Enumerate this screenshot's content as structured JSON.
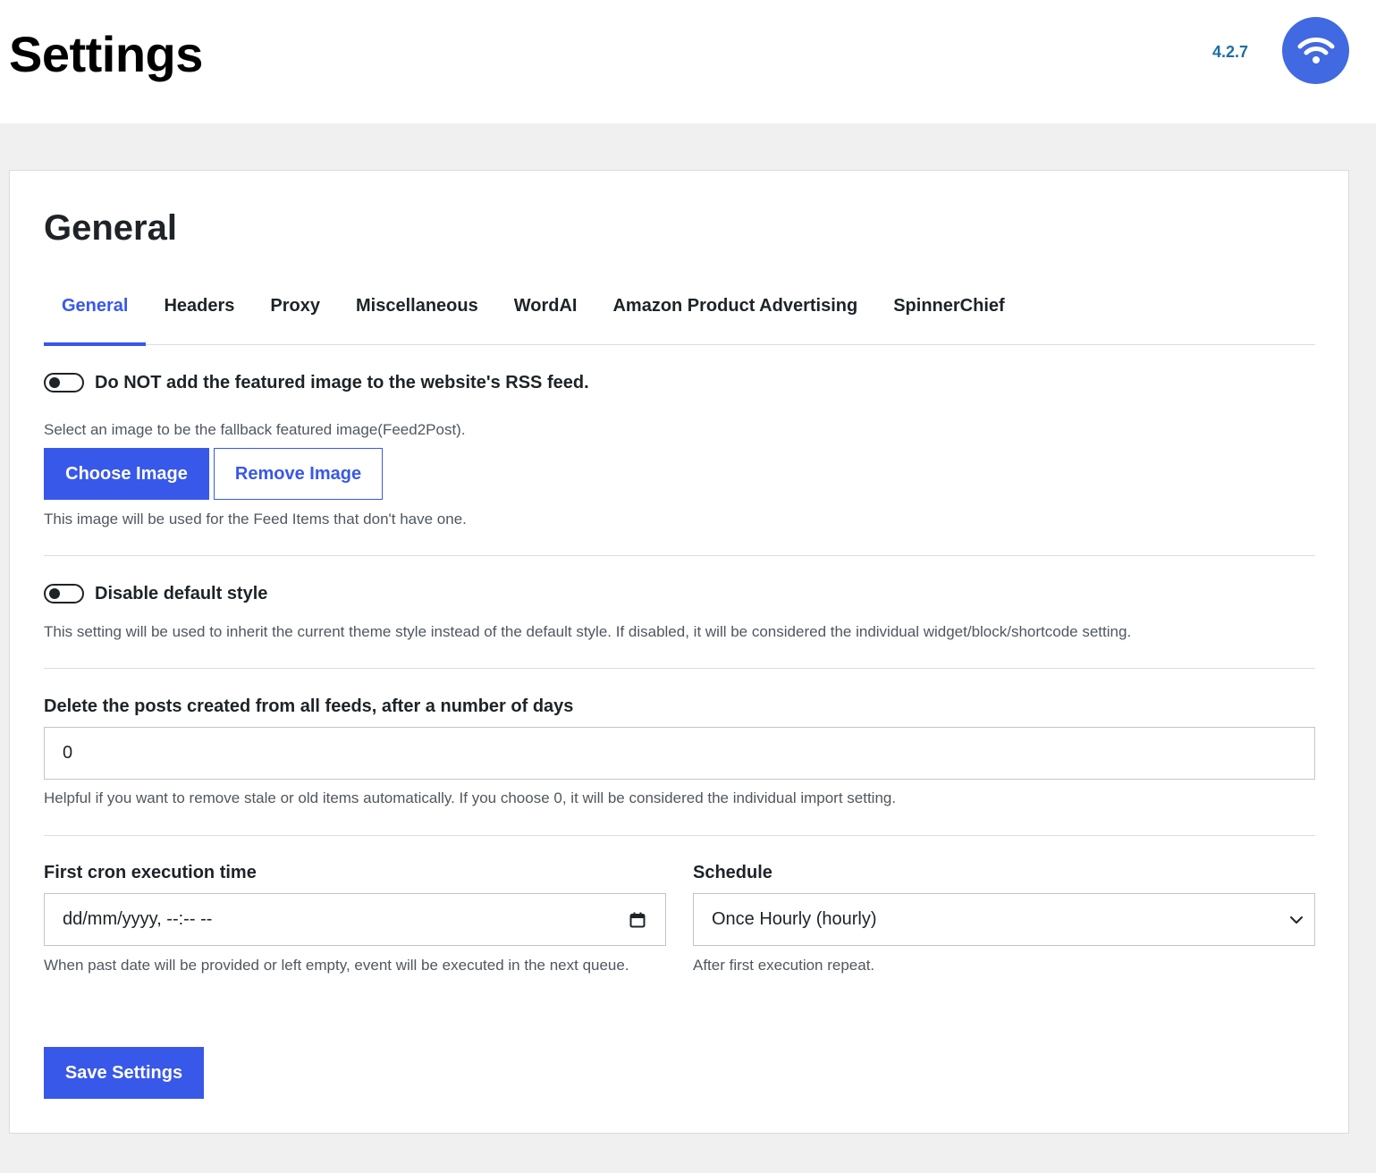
{
  "header": {
    "title": "Settings",
    "version": "4.2.7",
    "logo_icon": "wifi-feed-icon",
    "logo_color": "#4169e1"
  },
  "card": {
    "title": "General"
  },
  "tabs": [
    {
      "label": "General",
      "active": true
    },
    {
      "label": "Headers",
      "active": false
    },
    {
      "label": "Proxy",
      "active": false
    },
    {
      "label": "Miscellaneous",
      "active": false
    },
    {
      "label": "WordAI",
      "active": false
    },
    {
      "label": "Amazon Product Advertising",
      "active": false
    },
    {
      "label": "SpinnerChief",
      "active": false
    }
  ],
  "settings": {
    "rss_toggle": {
      "label": "Do NOT add the featured image to the website's RSS feed.",
      "enabled": false
    },
    "fallback_image": {
      "label": "Select an image to be the fallback featured image(Feed2Post).",
      "choose_label": "Choose Image",
      "remove_label": "Remove Image",
      "help": "This image will be used for the Feed Items that don't have one."
    },
    "default_style": {
      "label": "Disable default style",
      "enabled": false,
      "help": "This setting will be used to inherit the current theme style instead of the default style. If disabled, it will be considered the individual widget/block/shortcode setting."
    },
    "delete_posts": {
      "label": "Delete the posts created from all feeds, after a number of days",
      "value": "0",
      "help": "Helpful if you want to remove stale or old items automatically. If you choose 0, it will be considered the individual import setting."
    },
    "cron_time": {
      "label": "First cron execution time",
      "placeholder": "dd/mm/yyyy, --:-- --",
      "icon": "calendar-icon",
      "help": "When past date will be provided or left empty, event will be executed in the next queue."
    },
    "schedule": {
      "label": "Schedule",
      "value": "Once Hourly (hourly)",
      "icon": "chevron-down-icon",
      "help": "After first execution repeat."
    }
  },
  "footer": {
    "save_label": "Save Settings"
  },
  "colors": {
    "accent": "#3858e9",
    "version_text": "#1d6fa5"
  }
}
